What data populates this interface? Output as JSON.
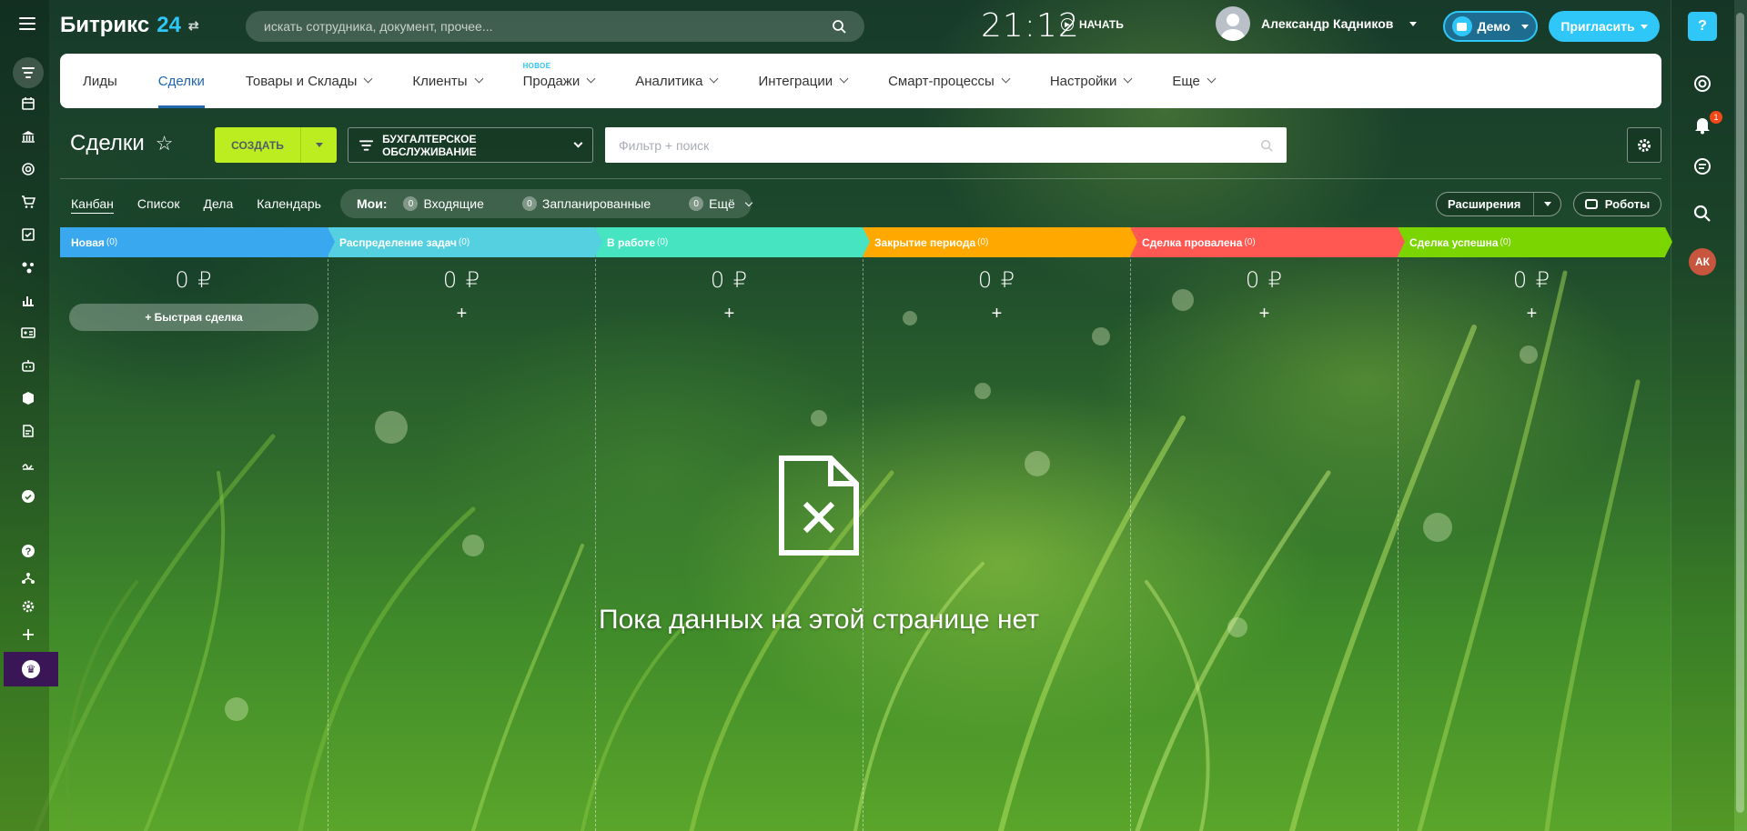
{
  "header": {
    "logo_text": "Битрикс",
    "logo_num": "24",
    "search_placeholder": "искать сотрудника, документ, прочее...",
    "clock": "21:12",
    "start_label": "НАЧАТЬ",
    "user_name": "Александр Кадников",
    "demo_label": "Демо",
    "invite_label": "Пригласить"
  },
  "topnav": {
    "new_tag": "НОВОЕ",
    "items": [
      "Лиды",
      "Сделки",
      "Товары и Склады",
      "Клиенты",
      "Продажи",
      "Аналитика",
      "Интеграции",
      "Смарт-процессы",
      "Настройки",
      "Еще"
    ],
    "active": "Сделки"
  },
  "toolbar": {
    "title": "Сделки",
    "create_label": "СОЗДАТЬ",
    "pipeline_label": "БУХГАЛТЕРСКОЕ ОБСЛУЖИВАНИЕ",
    "filter_placeholder": "Фильтр + поиск"
  },
  "views": {
    "items": [
      "Канбан",
      "Список",
      "Дела",
      "Календарь"
    ],
    "active": "Канбан"
  },
  "counters": {
    "label": "Мои:",
    "incoming": {
      "count": "0",
      "label": "Входящие"
    },
    "planned": {
      "count": "0",
      "label": "Запланированные"
    },
    "more": {
      "count": "0",
      "label": "Ещё"
    }
  },
  "actions": {
    "extensions_label": "Расширения",
    "robots_label": "Роботы"
  },
  "kanban": {
    "quick_deal_label": "+ Быстрая сделка",
    "columns": [
      {
        "title": "Новая",
        "count": "(0)",
        "sum": "0 ₽",
        "color": "#39a8ef"
      },
      {
        "title": "Распределение задач",
        "count": "(0)",
        "sum": "0 ₽",
        "color": "#55d0e0"
      },
      {
        "title": "В работе",
        "count": "(0)",
        "sum": "0 ₽",
        "color": "#47e4c2"
      },
      {
        "title": "Закрытие периода",
        "count": "(0)",
        "sum": "0 ₽",
        "color": "#ffa900"
      },
      {
        "title": "Сделка провалена",
        "count": "(0)",
        "sum": "0 ₽",
        "color": "#ff5752"
      },
      {
        "title": "Сделка успешна",
        "count": "(0)",
        "sum": "0 ₽",
        "color": "#7bd500"
      }
    ]
  },
  "empty_message": "Пока данных на этой странице нет",
  "right_bar": {
    "notifications_badge": "1",
    "avatar_initials": "АК",
    "help_label": "?"
  },
  "sidebar": {
    "icons": [
      "filter-icon",
      "calendar-icon",
      "bank-icon",
      "target-icon",
      "cart-icon",
      "checklist-icon",
      "nodes-icon",
      "chart-icon",
      "contact-card-icon",
      "robot-icon",
      "box-icon",
      "doc-edit-icon",
      "sign-icon",
      "check-circle-icon",
      "help-icon",
      "sitemap-icon",
      "gear-icon",
      "plus-icon",
      "crown-icon"
    ]
  }
}
